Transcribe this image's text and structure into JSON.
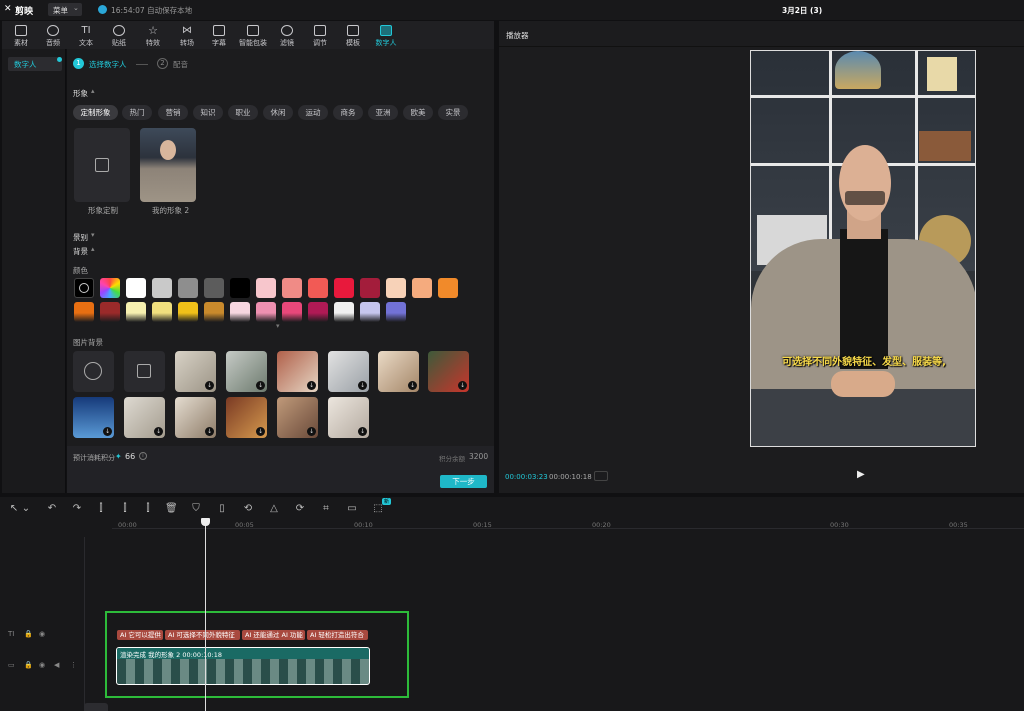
{
  "titlebar": {
    "app_name": "剪映",
    "menu_label": "菜单",
    "autosave_text": "16:54:07 自动保存本地",
    "project_name": "3月2日 (3)"
  },
  "toolbar": {
    "items": [
      "素材",
      "音频",
      "文本",
      "贴纸",
      "特效",
      "转场",
      "字幕",
      "智能包装",
      "滤镜",
      "调节",
      "模板",
      "数字人"
    ],
    "active": "数字人"
  },
  "leftnav": {
    "item": "数字人"
  },
  "steps": {
    "step1_num": "1",
    "step1": "选择数字人",
    "step2_num": "2",
    "step2": "配音"
  },
  "avatar": {
    "section_title": "形象",
    "tabs": [
      "定制形象",
      "热门",
      "营销",
      "知识",
      "职业",
      "休闲",
      "运动",
      "商务",
      "亚洲",
      "欧美",
      "实景"
    ],
    "custom_label": "形象定制",
    "my_label": "我的形象 2"
  },
  "scene_label": "景别",
  "background_label": "背景",
  "color_label": "颜色",
  "image_bg_label": "图片背景",
  "colors_row1": [
    "#ffffff",
    "#c9c9c9",
    "#8e8e8e",
    "#5c5c5c",
    "#000000",
    "#f7c6cc",
    "#f08b86",
    "#f25a55",
    "#e8193c",
    "#a31d3b",
    "#f7d2b8",
    "#f5ab7e",
    "#f18a2a"
  ],
  "colors_row2": [
    "#e86f12",
    "#9a2a2a",
    "#f6f0b0",
    "#f0df7e",
    "#f0c019",
    "#c98a2c",
    "#f7d6e0",
    "#ee90b1",
    "#e8487a",
    "#b01a55",
    "#f0f0f0",
    "#c6c6ee",
    "#7272d6"
  ],
  "bottom_bar": {
    "estimate_label": "预计消耗积分",
    "estimate_value": "66",
    "balance_label": "积分余额",
    "balance_value": "3200",
    "next_button": "下一步"
  },
  "player": {
    "title": "播放器",
    "subtitle": "可选择不同外貌特征、发型、服装等,",
    "current_time": "00:00:03:23",
    "total_time": "00:00:10:18"
  },
  "timeline": {
    "badge": "新",
    "ticks": [
      "00:00",
      "00:05",
      "00:10",
      "00:15",
      "00:20",
      "00:30",
      "00:35"
    ],
    "subtitle_clips": [
      "AI 它可以提供",
      "AI 可选择不同外貌特征",
      "AI 还能通过 AI 功能",
      "AI 轻松打造出符合"
    ],
    "video_clip_title": "渲染完成  我的形象 2  00:00:10:18"
  }
}
